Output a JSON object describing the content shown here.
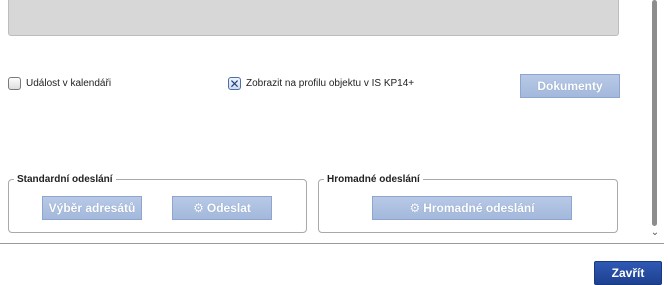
{
  "form": {
    "event_in_calendar": {
      "label": "Událost v kalendáři",
      "checked": false
    },
    "show_on_profile": {
      "label": "Zobrazit na profilu objektu v IS KP14+",
      "checked": true
    },
    "documents_button": "Dokumenty"
  },
  "standard_sending": {
    "legend": "Standardní odeslání",
    "select_recipients_button": "Výběr adresátů",
    "send_button": "Odeslat",
    "send_icon": "gears-icon"
  },
  "bulk_sending": {
    "legend": "Hromadné odeslání",
    "bulk_send_button": "Hromadné odeslání",
    "bulk_send_icon": "gears-icon"
  },
  "footer": {
    "close_button": "Zavřít"
  },
  "colors": {
    "disabled_button": "#a8bcdd",
    "primary_button": "#2a50a8"
  }
}
